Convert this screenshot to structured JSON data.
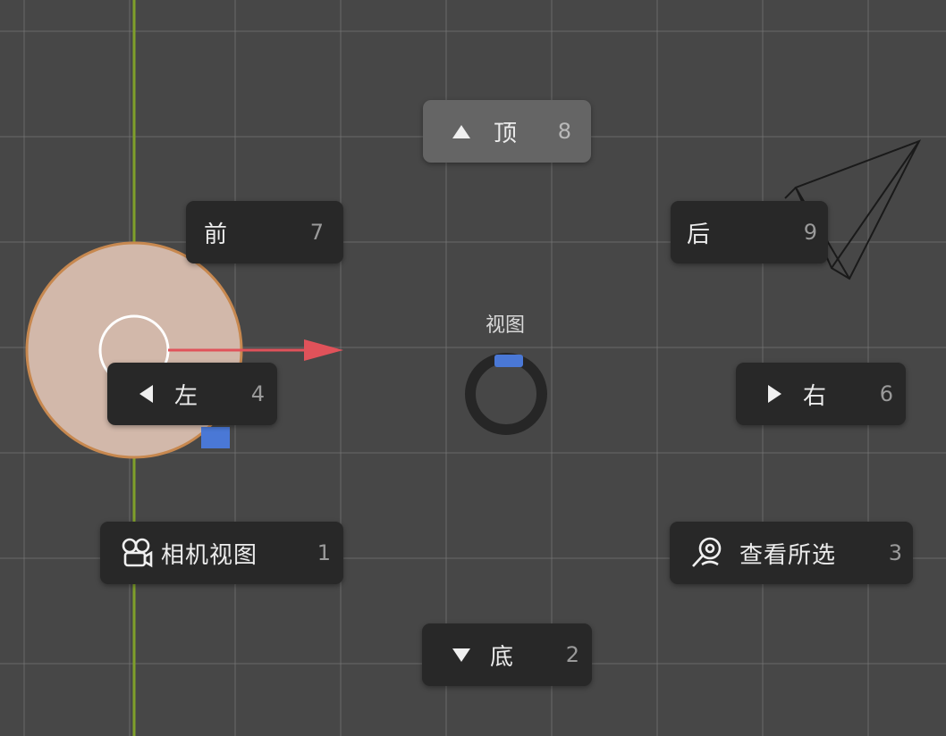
{
  "pie_menu": {
    "title": "视图",
    "top": {
      "label": "顶",
      "hotkey": "8",
      "icon": "arrow-up-icon"
    },
    "front": {
      "label": "前",
      "hotkey": "7"
    },
    "back": {
      "label": "后",
      "hotkey": "9"
    },
    "left": {
      "label": "左",
      "hotkey": "4",
      "icon": "arrow-left-icon"
    },
    "right": {
      "label": "右",
      "hotkey": "6",
      "icon": "arrow-right-icon"
    },
    "camera": {
      "label": "相机视图",
      "hotkey": "1",
      "icon": "camera-icon"
    },
    "view_selected": {
      "label": "查看所选",
      "hotkey": "3",
      "icon": "zoom-selected-icon"
    },
    "bottom": {
      "label": "底",
      "hotkey": "2",
      "icon": "arrow-down-icon"
    }
  },
  "colors": {
    "background": "#474747",
    "button_bg": "#282828",
    "button_active_bg": "#656565",
    "axis_y": "#7fa02a",
    "axis_x_arrow": "#e0525a",
    "gizmo_blue": "#4a78d6",
    "object_fill": "#d2b8aa",
    "object_outline": "#c7884f"
  }
}
